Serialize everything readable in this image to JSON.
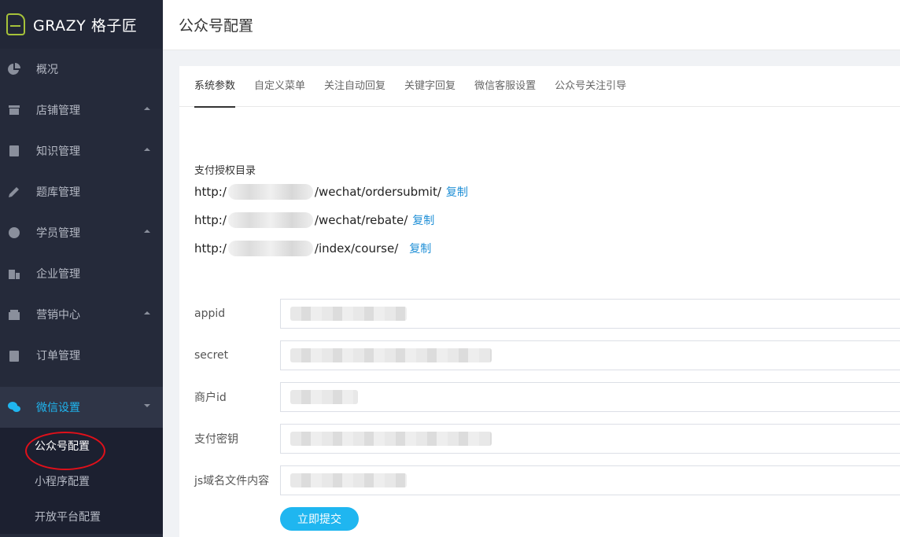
{
  "brand": {
    "name": "GRAZY 格子匠"
  },
  "sidebar": {
    "items": [
      {
        "label": "概况",
        "icon": "pie-chart-icon"
      },
      {
        "label": "店铺管理",
        "icon": "store-icon"
      },
      {
        "label": "知识管理",
        "icon": "book-icon"
      },
      {
        "label": "题库管理",
        "icon": "pencil-icon"
      },
      {
        "label": "学员管理",
        "icon": "user-icon"
      },
      {
        "label": "企业管理",
        "icon": "building-icon"
      },
      {
        "label": "营销中心",
        "icon": "gift-icon"
      },
      {
        "label": "订单管理",
        "icon": "clipboard-icon"
      },
      {
        "label": "微信设置",
        "icon": "wechat-icon"
      }
    ],
    "subitems": [
      "公众号配置",
      "小程序配置",
      "开放平台配置"
    ]
  },
  "header": {
    "title": "公众号配置"
  },
  "tabs": [
    "系统参数",
    "自定义菜单",
    "关注自动回复",
    "关键字回复",
    "微信客服设置",
    "公众号关注引导"
  ],
  "payment": {
    "label": "支付授权目录",
    "urls": [
      {
        "prefix": "http:/",
        "suffix": "/wechat/ordersubmit/"
      },
      {
        "prefix": "http:/",
        "suffix": "/wechat/rebate/"
      },
      {
        "prefix": "http:/",
        "suffix": "/index/course/"
      }
    ],
    "copy_label": "复制"
  },
  "form": {
    "fields": [
      {
        "label": "appid"
      },
      {
        "label": "secret"
      },
      {
        "label": "商户id"
      },
      {
        "label": "支付密钥"
      },
      {
        "label": "js域名文件内容"
      }
    ],
    "submit_label": "立即提交"
  },
  "colors": {
    "accent": "#1fb6f0",
    "sidebar_bg": "#252a3a",
    "link": "#1f8fd6",
    "annotation": "#e0101a"
  }
}
